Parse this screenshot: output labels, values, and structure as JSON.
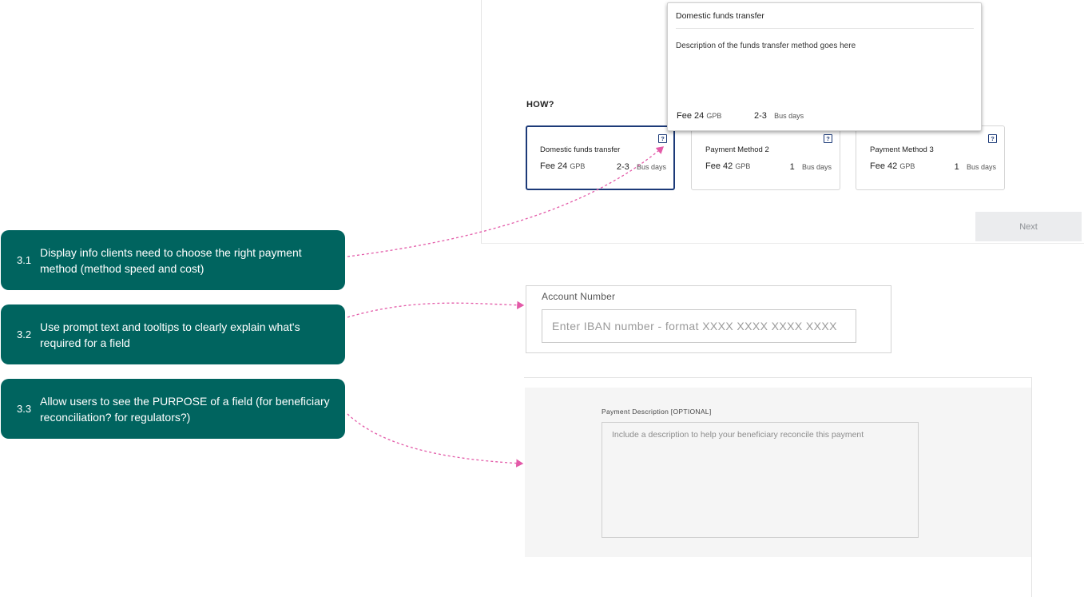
{
  "annotations": [
    {
      "number": "3.1",
      "text": "Display info clients need to choose the right payment method (method speed and cost)"
    },
    {
      "number": "3.2",
      "text": "Use prompt text and tooltips to clearly explain what's required for a field"
    },
    {
      "number": "3.3",
      "text": "Allow users to see the PURPOSE of a field (for beneficiary reconciliation? for regulators?)"
    }
  ],
  "payment": {
    "section_label": "HOW?",
    "methods": [
      {
        "name": "Domestic funds transfer",
        "fee_label": "Fee 24",
        "currency": "GPB",
        "days": "2-3",
        "days_unit": "Bus days",
        "selected": true
      },
      {
        "name": "Payment Method 2",
        "fee_label": "Fee 42",
        "currency": "GPB",
        "days": "1",
        "days_unit": "Bus days",
        "selected": false
      },
      {
        "name": "Payment Method 3",
        "fee_label": "Fee 42",
        "currency": "GPB",
        "days": "1",
        "days_unit": "Bus days",
        "selected": false
      }
    ],
    "help_icon_glyph": "?",
    "tooltip": {
      "title": "Domestic funds transfer",
      "description": "Description of the funds transfer method goes here",
      "fee_label": "Fee 24",
      "currency": "GPB",
      "days": "2-3",
      "days_unit": "Bus days"
    },
    "next_label": "Next"
  },
  "account": {
    "label": "Account Number",
    "value": "",
    "placeholder": "Enter IBAN number - format XXXX XXXX XXXX XXXX"
  },
  "description_field": {
    "label": "Payment Description [OPTIONAL]",
    "value": "",
    "placeholder": "Include a description to help your beneficiary reconcile this payment"
  },
  "colors": {
    "callout_bg": "#00645f",
    "arrow": "#e35aa8",
    "selected_border": "#1c3a78"
  }
}
